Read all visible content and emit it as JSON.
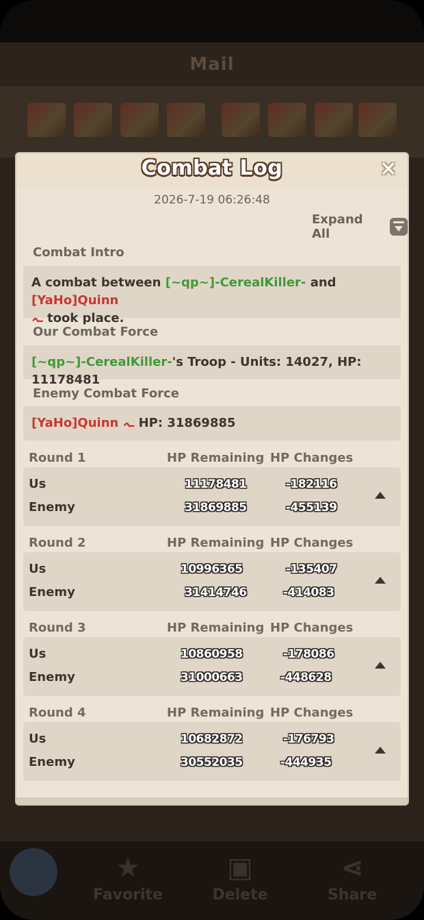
{
  "background": {
    "header_title": "Mail",
    "nav": [
      {
        "label": "Favorite",
        "icon": "star-icon"
      },
      {
        "label": "Delete",
        "icon": "trash-icon"
      },
      {
        "label": "Share",
        "icon": "share-icon"
      }
    ]
  },
  "dialog": {
    "title": "Combat Log",
    "timestamp": "2026-7-19 06:26:48",
    "expand_all": "Expand All",
    "intro": {
      "label": "Combat Intro",
      "prefix": "A combat between ",
      "attacker": "[~qp~]-CerealKiller-",
      "connector": " and ",
      "defender": "[YaHo]Quinn",
      "defender_mark": "ـہ",
      "suffix": " took place."
    },
    "our_force": {
      "label": "Our Combat Force",
      "name": "[~qp~]-CerealKiller-",
      "detail": "'s Troop - Units: 14027, HP: 11178481"
    },
    "enemy_force": {
      "label": "Enemy Combat Force",
      "name": "[YaHo]Quinn",
      "mark": "ـہ",
      "detail": "HP: 31869885"
    },
    "columns": {
      "remaining": "HP Remaining",
      "changes": "HP Changes"
    },
    "rows": {
      "us": "Us",
      "enemy": "Enemy"
    },
    "rounds": [
      {
        "title": "Round 1",
        "us_hp": "11178481",
        "us_change": "-182116",
        "enemy_hp": "31869885",
        "enemy_change": "-455139"
      },
      {
        "title": "Round 2",
        "us_hp": "10996365",
        "us_change": "-135407",
        "enemy_hp": "31414746",
        "enemy_change": "-414083"
      },
      {
        "title": "Round 3",
        "us_hp": "10860958",
        "us_change": "-178086",
        "enemy_hp": "31000663",
        "enemy_change": "-448628"
      },
      {
        "title": "Round 4",
        "us_hp": "10682872",
        "us_change": "-176793",
        "enemy_hp": "30552035",
        "enemy_change": "-444935"
      }
    ]
  }
}
